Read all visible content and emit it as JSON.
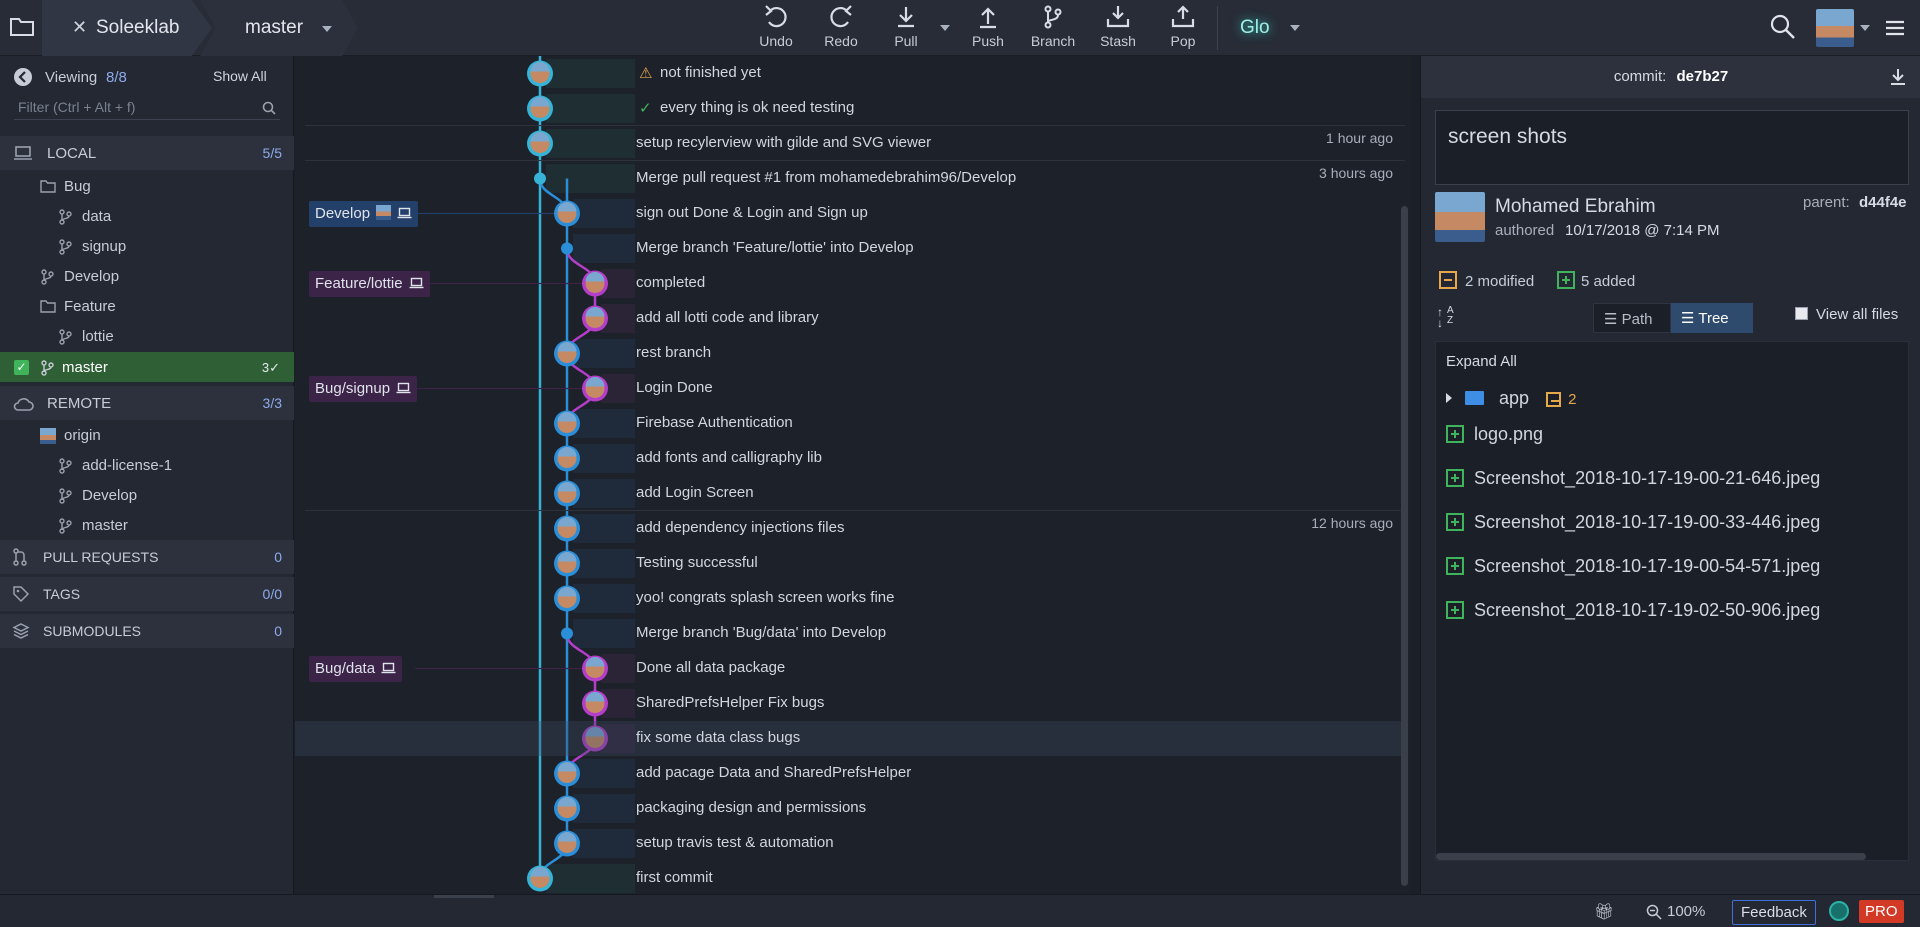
{
  "toolbar": {
    "repo_name": "Soleeklab",
    "branch_name": "master",
    "actions": [
      {
        "id": "undo",
        "label": "Undo"
      },
      {
        "id": "redo",
        "label": "Redo"
      },
      {
        "id": "pull",
        "label": "Pull"
      },
      {
        "id": "push",
        "label": "Push"
      },
      {
        "id": "branch",
        "label": "Branch"
      },
      {
        "id": "stash",
        "label": "Stash"
      },
      {
        "id": "pop",
        "label": "Pop"
      }
    ],
    "glo_label": "Glo"
  },
  "sidebar": {
    "viewing_label": "Viewing",
    "viewing_count": "8/8",
    "show_all": "Show All",
    "filter_placeholder": "Filter (Ctrl + Alt + f)",
    "local": {
      "label": "LOCAL",
      "count": "5/5"
    },
    "local_items": [
      {
        "label": "Bug",
        "type": "folder",
        "indent": 1
      },
      {
        "label": "data",
        "type": "branch",
        "indent": 2
      },
      {
        "label": "signup",
        "type": "branch",
        "indent": 2
      },
      {
        "label": "Develop",
        "type": "branch",
        "indent": 1
      },
      {
        "label": "Feature",
        "type": "folder",
        "indent": 1
      },
      {
        "label": "lottie",
        "type": "branch",
        "indent": 2
      }
    ],
    "master": {
      "label": "master",
      "badge": "3✓"
    },
    "remote": {
      "label": "REMOTE",
      "count": "3/3"
    },
    "remote_items": [
      {
        "label": "origin",
        "type": "remote",
        "indent": 1
      },
      {
        "label": "add-license-1",
        "type": "branch",
        "indent": 2
      },
      {
        "label": "Develop",
        "type": "branch",
        "indent": 2
      },
      {
        "label": "master",
        "type": "branch",
        "indent": 2
      }
    ],
    "pull_requests": {
      "label": "PULL REQUESTS",
      "count": "0"
    },
    "tags": {
      "label": "TAGS",
      "count": "0/0"
    },
    "submodules": {
      "label": "SUBMODULES",
      "count": "0"
    }
  },
  "graph": {
    "branch_labels": [
      {
        "text": "Develop",
        "row": 4
      },
      {
        "text": "Feature/lottie",
        "row": 6
      },
      {
        "text": "Bug/signup",
        "row": 9
      },
      {
        "text": "Bug/data",
        "row": 17
      }
    ],
    "commits": [
      {
        "message": "not finished yet",
        "time": "",
        "icon": "warning"
      },
      {
        "message": "every thing is ok need testing",
        "time": "",
        "icon": "check"
      },
      {
        "message": "setup recylerview with gilde and SVG viewer",
        "time": "1 hour ago",
        "icon": ""
      },
      {
        "message": "Merge pull request #1 from mohamedebrahim96/Develop",
        "time": "3 hours ago",
        "icon": ""
      },
      {
        "message": "sign out Done & Login and Sign up",
        "time": "",
        "icon": ""
      },
      {
        "message": "Merge branch 'Feature/lottie' into Develop",
        "time": "",
        "icon": ""
      },
      {
        "message": "completed",
        "time": "",
        "icon": ""
      },
      {
        "message": "add all lotti code and library",
        "time": "",
        "icon": ""
      },
      {
        "message": "rest branch",
        "time": "",
        "icon": ""
      },
      {
        "message": "Login Done",
        "time": "",
        "icon": ""
      },
      {
        "message": "Firebase Authentication",
        "time": "",
        "icon": ""
      },
      {
        "message": "add fonts and calligraphy lib",
        "time": "",
        "icon": ""
      },
      {
        "message": "add Login Screen",
        "time": "",
        "icon": ""
      },
      {
        "message": "add dependency injections files",
        "time": "12 hours ago",
        "icon": ""
      },
      {
        "message": "Testing successful",
        "time": "",
        "icon": ""
      },
      {
        "message": "yoo! congrats splash screen works fine",
        "time": "",
        "icon": ""
      },
      {
        "message": "Merge branch 'Bug/data' into Develop",
        "time": "",
        "icon": ""
      },
      {
        "message": "Done all data package",
        "time": "",
        "icon": ""
      },
      {
        "message": "SharedPrefsHelper Fix bugs",
        "time": "",
        "icon": ""
      },
      {
        "message": "fix some data class bugs",
        "time": "",
        "icon": ""
      },
      {
        "message": "add pacage Data and SharedPrefsHelper",
        "time": "",
        "icon": ""
      },
      {
        "message": "packaging design and permissions",
        "time": "",
        "icon": ""
      },
      {
        "message": "setup travis test & automation",
        "time": "",
        "icon": ""
      },
      {
        "message": "first commit",
        "time": "",
        "icon": ""
      }
    ]
  },
  "detail": {
    "commit_label": "commit:",
    "commit_sha": "de7b27",
    "summary": "screen shots",
    "author": "Mohamed Ebrahim",
    "authored_label": "authored",
    "authored_date": "10/17/2018 @ 7:14 PM",
    "parent_label": "parent:",
    "parent_sha": "d44f4e",
    "modified": "2 modified",
    "added": "5 added",
    "path_label": "Path",
    "tree_label": "Tree",
    "view_all_files": "View all files",
    "expand_all": "Expand All",
    "folder": {
      "name": "app",
      "count": "2"
    },
    "files": [
      "logo.png",
      "Screenshot_2018-10-17-19-00-21-646.jpeg",
      "Screenshot_2018-10-17-19-00-33-446.jpeg",
      "Screenshot_2018-10-17-19-00-54-571.jpeg",
      "Screenshot_2018-10-17-19-02-50-906.jpeg"
    ]
  },
  "statusbar": {
    "zoom": "100%",
    "feedback": "Feedback",
    "pro": "PRO"
  },
  "colors": {
    "develop_lane": "#2a8fd8",
    "feature_lane": "#b43ec9",
    "master_lane": "#36b3d6",
    "added": "#3fb45a",
    "modified": "#e5a84a"
  }
}
